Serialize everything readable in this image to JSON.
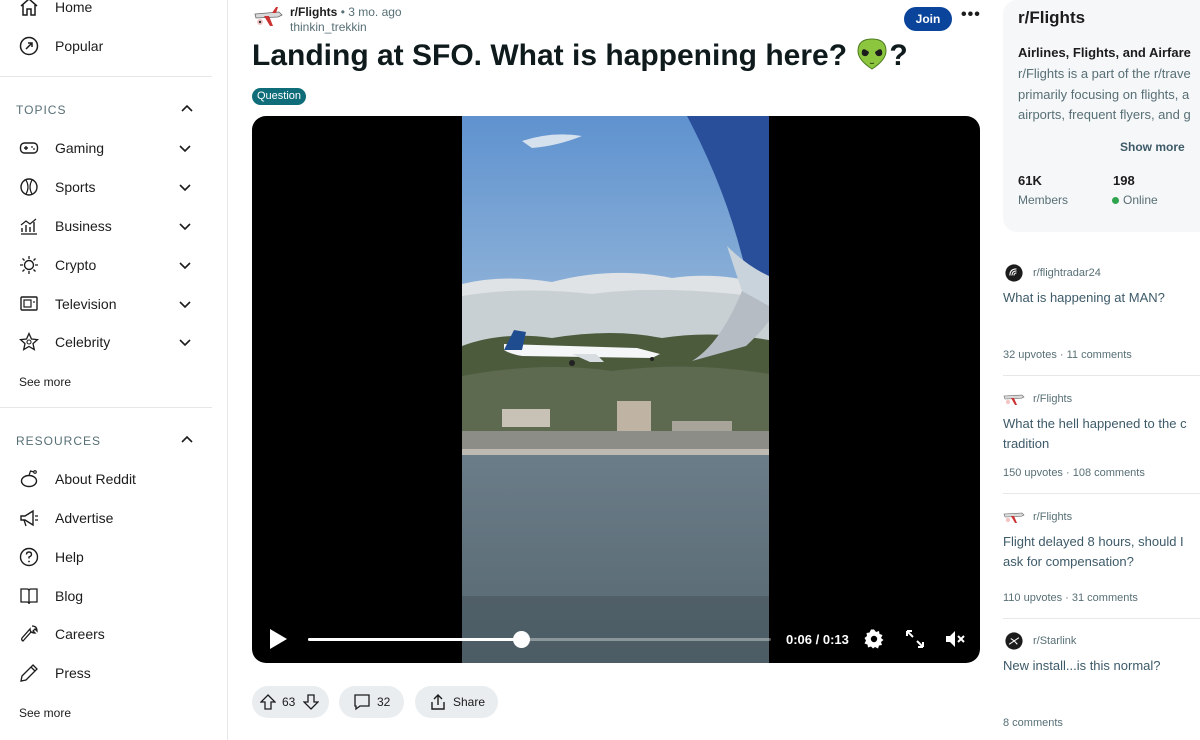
{
  "sidebar": {
    "top_items": [
      {
        "label": "Home",
        "icon": "home-icon"
      },
      {
        "label": "Popular",
        "icon": "popular-icon"
      }
    ],
    "topics": {
      "title": "TOPICS",
      "items": [
        {
          "label": "Gaming",
          "icon": "gamepad-icon"
        },
        {
          "label": "Sports",
          "icon": "sports-ball-icon"
        },
        {
          "label": "Business",
          "icon": "chart-icon"
        },
        {
          "label": "Crypto",
          "icon": "crypto-icon"
        },
        {
          "label": "Television",
          "icon": "tv-icon"
        },
        {
          "label": "Celebrity",
          "icon": "star-icon"
        }
      ],
      "see_more": "See more"
    },
    "resources": {
      "title": "RESOURCES",
      "items": [
        {
          "label": "About Reddit",
          "icon": "reddit-icon"
        },
        {
          "label": "Advertise",
          "icon": "megaphone-icon"
        },
        {
          "label": "Help",
          "icon": "help-icon"
        },
        {
          "label": "Blog",
          "icon": "book-icon"
        },
        {
          "label": "Careers",
          "icon": "wrench-icon"
        },
        {
          "label": "Press",
          "icon": "pen-icon"
        }
      ],
      "see_more": "See more"
    }
  },
  "post": {
    "subreddit": "r/Flights",
    "time": "• 3 mo. ago",
    "author": "thinkin_trekkin",
    "join_label": "Join",
    "more_label": "•••",
    "title_before": "Landing at SFO. What is happening here?",
    "title_after": "?",
    "flair": "Question",
    "video": {
      "current_time": "0:06",
      "duration": "0:13",
      "time_display": "0:06 / 0:13",
      "progress": 0.46
    },
    "upvotes": "63",
    "comments": "32",
    "share_label": "Share"
  },
  "about": {
    "title": "r/Flights",
    "subtitle": "Airlines, Flights, and Airfare",
    "description_lines": [
      "r/Flights is a part of the r/trave",
      "primarily focusing on flights, a",
      "airports, frequent flyers, and g"
    ],
    "show_more": "Show more",
    "members_value": "61K",
    "members_label": "Members",
    "online_value": "198",
    "online_label": "Online"
  },
  "related": [
    {
      "subreddit": "r/flightradar24",
      "title_lines": [
        "What is happening at MAN?"
      ],
      "meta": "32 upvotes · 11 comments"
    },
    {
      "subreddit": "r/Flights",
      "title_lines": [
        "What the hell happened to the c",
        "tradition"
      ],
      "meta": "150 upvotes · 108 comments"
    },
    {
      "subreddit": "r/Flights",
      "title_lines": [
        "Flight delayed 8 hours, should I",
        "ask for compensation?"
      ],
      "meta": "110 upvotes · 31 comments"
    },
    {
      "subreddit": "r/Starlink",
      "title_lines": [
        "New install...is this normal?"
      ],
      "meta": "8 comments"
    }
  ]
}
